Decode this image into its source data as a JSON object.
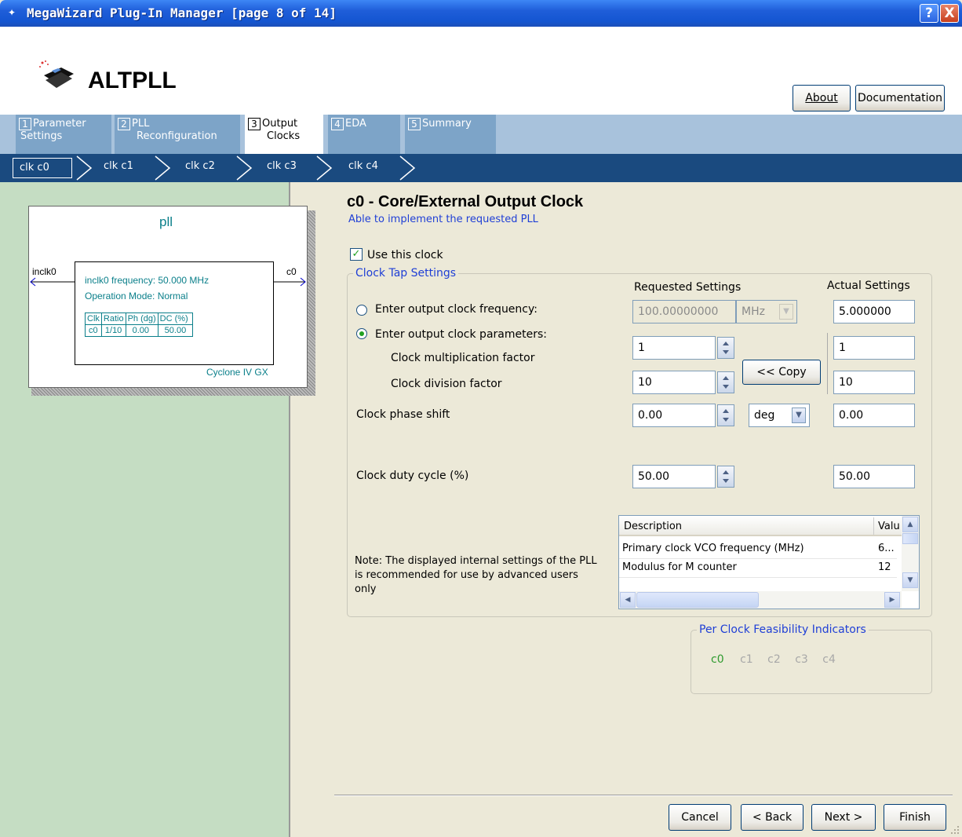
{
  "window": {
    "title": "MegaWizard Plug-In Manager [page 8 of 14]",
    "help_glyph": "?",
    "close_glyph": "X"
  },
  "header": {
    "app_title": "ALTPLL",
    "about_label": "About",
    "documentation_label": "Documentation"
  },
  "tabs": [
    {
      "num": "1",
      "line1": "Parameter",
      "line2": "Settings"
    },
    {
      "num": "2",
      "line1": "PLL",
      "line2": "Reconfiguration"
    },
    {
      "num": "3",
      "line1": "Output",
      "line2": "Clocks"
    },
    {
      "num": "4",
      "line1": "EDA",
      "line2": ""
    },
    {
      "num": "5",
      "line1": "Summary",
      "line2": ""
    }
  ],
  "clk_tabs": [
    "clk c0",
    "clk c1",
    "clk c2",
    "clk c3",
    "clk c4"
  ],
  "pll_diagram": {
    "name": "pll",
    "input": "inclk0",
    "output": "c0",
    "frequency": "inclk0 frequency: 50.000 MHz",
    "mode": "Operation Mode: Normal",
    "table_headers": [
      "Clk",
      "Ratio",
      "Ph (dg)",
      "DC (%)"
    ],
    "table_row": [
      "c0",
      "1/10",
      "0.00",
      "50.00"
    ],
    "device": "Cyclone IV GX"
  },
  "main": {
    "heading": "c0 - Core/External Output Clock",
    "status": "Able to implement the requested PLL",
    "use_clock_label": "Use this clock",
    "group_label": "Clock Tap Settings",
    "requested_header": "Requested Settings",
    "actual_header": "Actual Settings",
    "freq_radio_label": "Enter output clock frequency:",
    "params_radio_label": "Enter output clock parameters:",
    "mult_label": "Clock multiplication factor",
    "div_label": "Clock division factor",
    "phase_label": "Clock phase shift",
    "duty_label": "Clock duty cycle (%)",
    "freq_value": "100.00000000",
    "freq_unit": "MHz",
    "actual_freq": "5.000000",
    "mult_value": "1",
    "actual_mult": "1",
    "div_value": "10",
    "actual_div": "10",
    "copy_label": "<< Copy",
    "phase_value": "0.00",
    "phase_unit": "deg",
    "actual_phase": "0.00",
    "duty_value": "50.00",
    "actual_duty": "50.00",
    "note": "Note: The displayed internal settings of the PLL is recommended for use by advanced users only",
    "table": {
      "headers": [
        "Description",
        "Valu"
      ],
      "rows": [
        [
          "Primary clock VCO frequency (MHz)",
          "6..."
        ],
        [
          "Modulus for M counter",
          "12"
        ]
      ]
    },
    "feasibility_label": "Per Clock Feasibility Indicators",
    "feasibility": [
      "c0",
      "c1",
      "c2",
      "c3",
      "c4"
    ],
    "feasibility_ok_color": "#2e9a2e",
    "feasibility_off_color": "#a8a8a8"
  },
  "footer": {
    "cancel": "Cancel",
    "back": "< Back",
    "next": "Next >",
    "finish": "Finish"
  }
}
